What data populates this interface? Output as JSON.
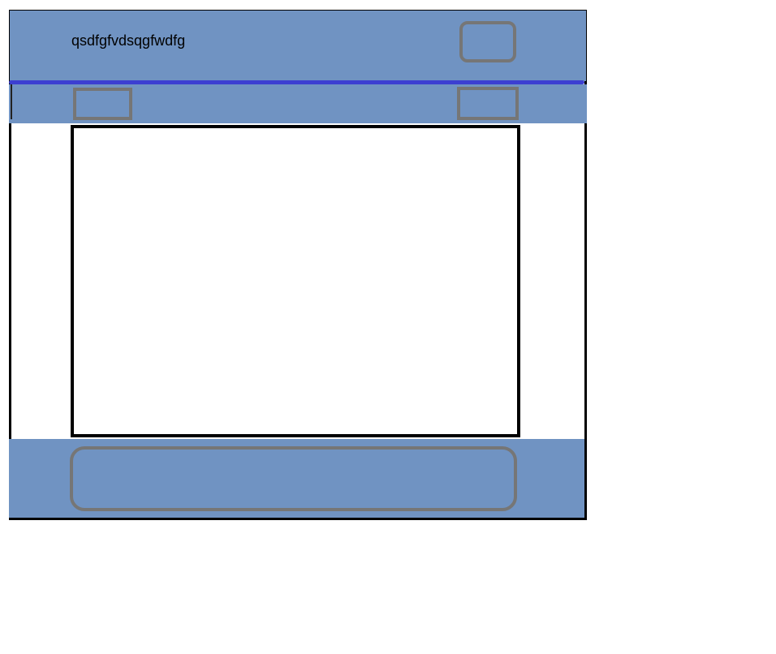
{
  "colors": {
    "panel": "#7093c2",
    "accent": "#3c3fd1",
    "control_border": "#767676",
    "frame_border": "#000000"
  },
  "header": {
    "title": "qsdfgfvdsqgfwdfg"
  }
}
